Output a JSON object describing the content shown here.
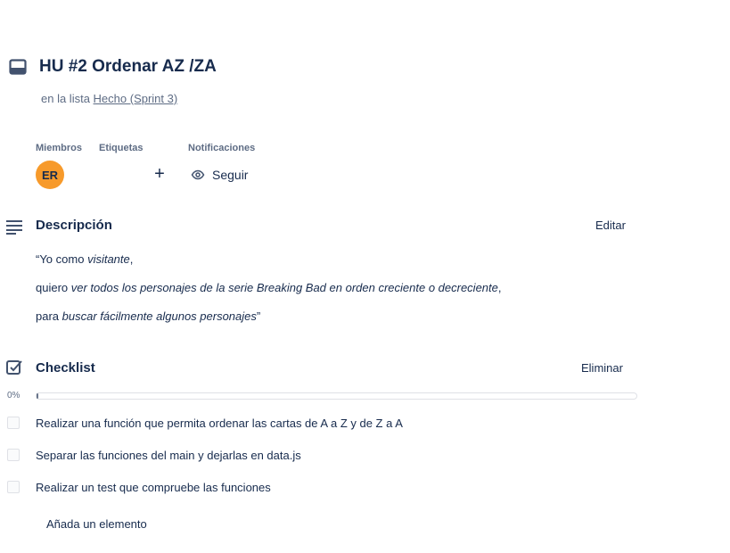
{
  "card": {
    "title": "HU #2 Ordenar AZ /ZA",
    "in_list_prefix": "en la lista ",
    "list_name": "Hecho (Sprint 3)"
  },
  "meta": {
    "members_label": "Miembros",
    "labels_label": "Etiquetas",
    "notifications_label": "Notificaciones",
    "member_initials": "ER",
    "add_label_glyph": "+",
    "follow_label": "Seguir"
  },
  "description": {
    "title": "Descripción",
    "edit_label": "Editar",
    "line1": {
      "prefix": "“Yo como ",
      "em": "visitante",
      "suffix": ","
    },
    "line2": {
      "prefix": "quiero ",
      "em": "ver todos los personajes de la serie Breaking Bad en orden creciente o decreciente",
      "suffix": ","
    },
    "line3": {
      "prefix": "para ",
      "em": "buscar fácilmente algunos personajes",
      "suffix": "”"
    }
  },
  "checklist": {
    "title": "Checklist",
    "delete_label": "Eliminar",
    "progress_text": "0%",
    "progress": 0,
    "items": [
      {
        "text": "Realizar una función que permita ordenar las cartas de A a Z y de Z a A",
        "checked": false
      },
      {
        "text": "Separar las funciones del main y dejarlas en data.js",
        "checked": false
      },
      {
        "text": "Realizar un test que compruebe las funciones",
        "checked": false
      }
    ],
    "add_item_label": "Añada un elemento"
  },
  "colors": {
    "text": "#172b4d",
    "subtle": "#5e6c84",
    "avatar": "#f79a2b",
    "border": "#dfe1e6"
  }
}
